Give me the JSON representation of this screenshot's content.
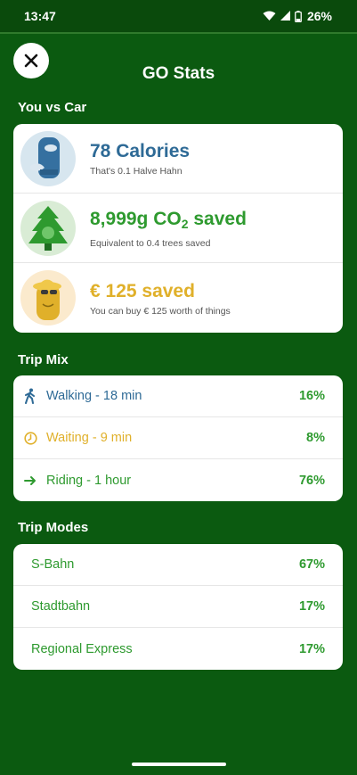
{
  "status_bar": {
    "time": "13:47",
    "battery": "26%"
  },
  "header": {
    "title": "GO Stats"
  },
  "you_vs_car": {
    "title": "You vs Car",
    "calories": {
      "main": "78 Calories",
      "sub": "That's 0.1 Halve Hahn",
      "color": "#2e6a96"
    },
    "co2": {
      "main_prefix": "8,999g CO",
      "main_subscript": "2",
      "main_suffix": " saved",
      "sub": "Equivalent to 0.4 trees saved",
      "color": "#2e9a2f"
    },
    "money": {
      "main": "€ 125 saved",
      "sub": "You can buy € 125 worth of things",
      "color": "#e0b02a"
    }
  },
  "trip_mix": {
    "title": "Trip Mix",
    "items": [
      {
        "label": "Walking - 18 min",
        "pct": "16%",
        "icon": "walking-icon",
        "color": "#2e6a96"
      },
      {
        "label": "Waiting - 9 min",
        "pct": "8%",
        "icon": "clock-icon",
        "color": "#e0b02a"
      },
      {
        "label": "Riding - 1 hour",
        "pct": "76%",
        "icon": "arrow-right-icon",
        "color": "#2e9a2f"
      }
    ]
  },
  "trip_modes": {
    "title": "Trip Modes",
    "items": [
      {
        "label": "S-Bahn",
        "pct": "67%"
      },
      {
        "label": "Stadtbahn",
        "pct": "17%"
      },
      {
        "label": "Regional Express",
        "pct": "17%"
      }
    ]
  }
}
